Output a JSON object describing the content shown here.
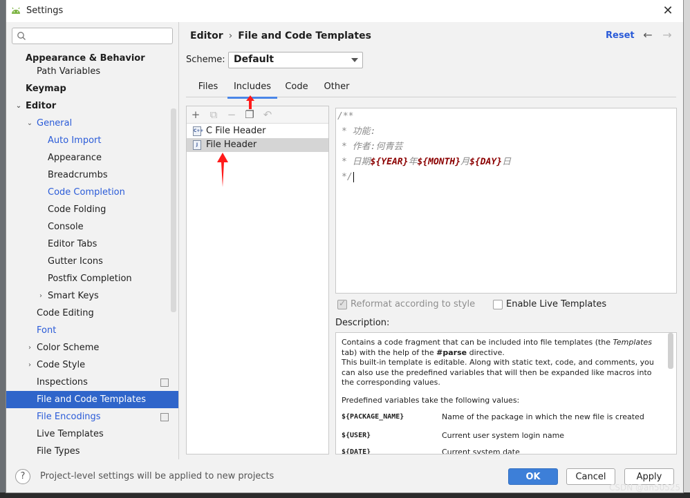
{
  "window": {
    "title": "Settings"
  },
  "search": {
    "placeholder": ""
  },
  "sidebar": {
    "items": [
      {
        "label": "Appearance & Behavior"
      },
      {
        "label": "Path Variables"
      },
      {
        "label": "Keymap"
      },
      {
        "label": "Editor"
      },
      {
        "label": "General"
      },
      {
        "label": "Auto Import"
      },
      {
        "label": "Appearance"
      },
      {
        "label": "Breadcrumbs"
      },
      {
        "label": "Code Completion"
      },
      {
        "label": "Code Folding"
      },
      {
        "label": "Console"
      },
      {
        "label": "Editor Tabs"
      },
      {
        "label": "Gutter Icons"
      },
      {
        "label": "Postfix Completion"
      },
      {
        "label": "Smart Keys"
      },
      {
        "label": "Code Editing"
      },
      {
        "label": "Font"
      },
      {
        "label": "Color Scheme"
      },
      {
        "label": "Code Style"
      },
      {
        "label": "Inspections"
      },
      {
        "label": "File and Code Templates"
      },
      {
        "label": "File Encodings"
      },
      {
        "label": "Live Templates"
      },
      {
        "label": "File Types"
      }
    ]
  },
  "header": {
    "breadcrumb_root": "Editor",
    "breadcrumb_sep": "›",
    "breadcrumb_current": "File and Code Templates",
    "reset": "Reset"
  },
  "scheme": {
    "label": "Scheme:",
    "value": "Default"
  },
  "tabs": [
    {
      "label": "Files"
    },
    {
      "label": "Includes"
    },
    {
      "label": "Code"
    },
    {
      "label": "Other"
    }
  ],
  "templates": [
    {
      "icon_text": "C++",
      "label": "C File Header"
    },
    {
      "icon_text": "J",
      "label": "File Header"
    }
  ],
  "editor": {
    "line1": "/**",
    "line2": "* 功能:",
    "line3": "* 作者:何青芸",
    "line4_prefix": "* 日期",
    "var_year": "${YEAR}",
    "sep_year": "年",
    "var_month": "${MONTH}",
    "sep_month": "月",
    "var_day": "${DAY}",
    "sep_day": "日",
    "line5": "*/"
  },
  "options": {
    "reformat": "Reformat according to style",
    "live_templates": "Enable Live Templates"
  },
  "description": {
    "label": "Description:",
    "p1_a": "Contains a code fragment that can be included into file templates (the ",
    "p1_templates": "Templates",
    "p1_b": " tab) with the help of the ",
    "p1_parse": "#parse",
    "p1_c": " directive.",
    "p2": "This built-in template is editable. Along with static text, code, and comments, you can also use the predefined variables that will then be expanded like macros into the corresponding values.",
    "p3": "Predefined variables take the following values:",
    "vars": [
      {
        "name": "${PACKAGE_NAME}",
        "desc": "Name of the package in which the new file is created"
      },
      {
        "name": "${USER}",
        "desc": "Current user system login name"
      },
      {
        "name": "${DATE}",
        "desc": "Current system date"
      }
    ]
  },
  "footer": {
    "help": "?",
    "note": "Project-level settings will be applied to new projects",
    "ok": "OK",
    "cancel": "Cancel",
    "apply": "Apply"
  },
  "watermark": "CSDN @an50525",
  "colors": {
    "accent": "#2f65ca",
    "link": "#2a5bd8",
    "ok_button": "#3d7fd8",
    "annotation_arrow": "#ff1a1a"
  }
}
